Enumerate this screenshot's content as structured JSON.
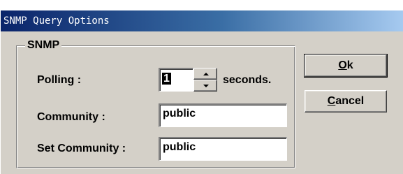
{
  "window": {
    "title": "SNMP Query Options"
  },
  "group": {
    "label": "SNMP"
  },
  "polling": {
    "label": "Polling :",
    "value": "1",
    "unit": "seconds."
  },
  "community": {
    "label": "Community :",
    "value": "public"
  },
  "set_community": {
    "label": "Set Community :",
    "value": "public"
  },
  "buttons": {
    "ok": {
      "mnemonic": "O",
      "rest": "k"
    },
    "cancel": {
      "mnemonic": "C",
      "rest": "ancel"
    }
  },
  "icons": {
    "spin_up": "spin-up-icon",
    "spin_down": "spin-down-icon"
  },
  "colors": {
    "title_start": "#0a246a",
    "title_end": "#a6caf0",
    "face": "#d4d0c8"
  }
}
